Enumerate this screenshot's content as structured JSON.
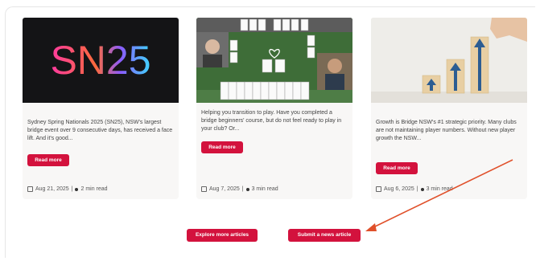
{
  "articles": [
    {
      "thumb_text": "SN25",
      "excerpt": "Sydney Spring Nationals 2025 (SN25), NSW's largest bridge event over 9 consecutive days, has received a face lift. And it's good...",
      "read_more": "Read more",
      "date": "Aug 21, 2025",
      "separator": "|",
      "read_time": "2 min read"
    },
    {
      "excerpt": "Helping you transition to play. Have you completed a bridge beginners' course, but do not feel ready to play in your club? Or...",
      "read_more": "Read more",
      "date": "Aug 7, 2025",
      "separator": "|",
      "read_time": "3 min read"
    },
    {
      "excerpt": "Growth is Bridge NSW's #1 strategic priority. Many clubs are not maintaining player numbers. Without new player growth the NSW...",
      "read_more": "Read more",
      "date": "Aug 6, 2025",
      "separator": "|",
      "read_time": "3 min read"
    }
  ],
  "footer": {
    "explore_label": "Explore more articles",
    "submit_label": "Submit a news article"
  },
  "colors": {
    "accent": "#d3123d",
    "annotation_arrow": "#e0502a"
  }
}
